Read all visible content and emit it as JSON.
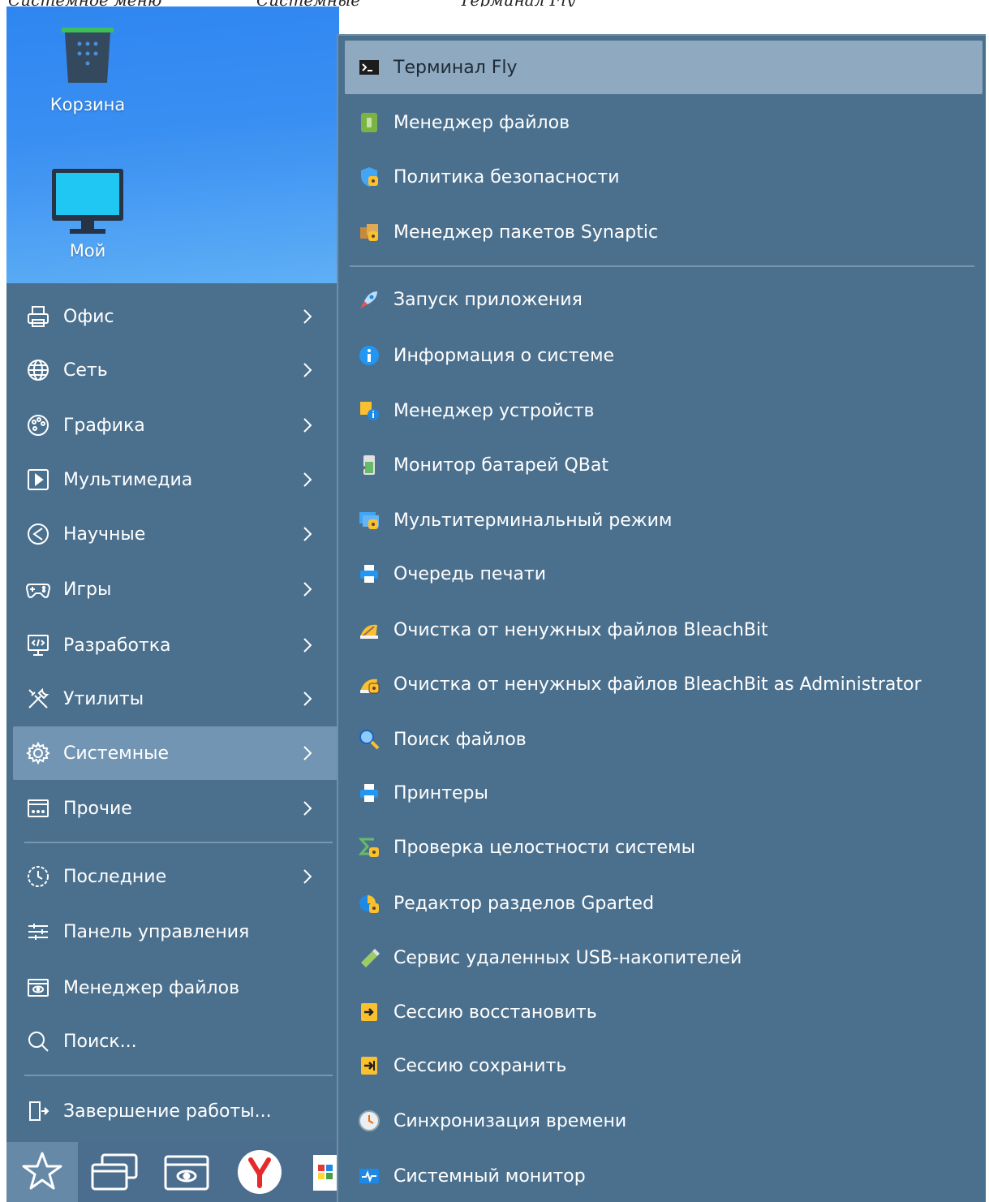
{
  "caption": {
    "left": "Системное меню",
    "middle": "Системные",
    "right": "Терминал Fly"
  },
  "desktop": {
    "trash_label": "Корзина",
    "computer_label": "Мой"
  },
  "start_menu": {
    "categories": [
      {
        "label": "Офис",
        "icon": "printer-icon"
      },
      {
        "label": "Сеть",
        "icon": "globe-icon"
      },
      {
        "label": "Графика",
        "icon": "palette-icon"
      },
      {
        "label": "Мультимедиа",
        "icon": "play-icon"
      },
      {
        "label": "Научные",
        "icon": "science-icon"
      },
      {
        "label": "Игры",
        "icon": "gamepad-icon"
      },
      {
        "label": "Разработка",
        "icon": "code-monitor-icon"
      },
      {
        "label": "Утилиты",
        "icon": "tools-icon"
      },
      {
        "label": "Системные",
        "icon": "gear-icon",
        "active": true
      },
      {
        "label": "Прочие",
        "icon": "window-icon"
      }
    ],
    "extras": [
      {
        "label": "Последние",
        "icon": "history-icon"
      },
      {
        "label": "Панель управления",
        "icon": "sliders-icon"
      },
      {
        "label": "Менеджер файлов",
        "icon": "file-manager-icon"
      },
      {
        "label": "Поиск...",
        "icon": "search-icon"
      }
    ],
    "shutdown_label": "Завершение работы..."
  },
  "submenu": {
    "items": [
      {
        "label": "Терминал Fly",
        "icon": "terminal-icon",
        "active": true
      },
      {
        "label": "Менеджер файлов",
        "icon": "file-manager-icon"
      },
      {
        "label": "Политика безопасности",
        "icon": "shield-icon"
      },
      {
        "label": "Менеджер пакетов Synaptic",
        "icon": "package-icon"
      },
      {
        "label": "Запуск приложения",
        "icon": "rocket-icon"
      },
      {
        "label": "Информация о системе",
        "icon": "info-icon"
      },
      {
        "label": "Менеджер устройств",
        "icon": "devices-icon"
      },
      {
        "label": "Монитор батарей QBat",
        "icon": "battery-icon"
      },
      {
        "label": "Мультитерминальный режим",
        "icon": "multiterminal-icon"
      },
      {
        "label": "Очередь печати",
        "icon": "print-queue-icon"
      },
      {
        "label": "Очистка от ненужных файлов BleachBit",
        "icon": "broom-icon"
      },
      {
        "label": "Очистка от ненужных файлов BleachBit as Administrator",
        "icon": "broom-admin-icon"
      },
      {
        "label": "Поиск файлов",
        "icon": "magnifier-icon"
      },
      {
        "label": "Принтеры",
        "icon": "printer-icon"
      },
      {
        "label": "Проверка целостности системы",
        "icon": "sigma-icon"
      },
      {
        "label": "Редактор разделов Gparted",
        "icon": "gparted-icon"
      },
      {
        "label": "Сервис удаленных USB-накопителей",
        "icon": "usb-icon"
      },
      {
        "label": "Сессию восстановить",
        "icon": "session-restore-icon"
      },
      {
        "label": "Сессию сохранить",
        "icon": "session-save-icon"
      },
      {
        "label": "Синхронизация времени",
        "icon": "clock-icon"
      },
      {
        "label": "Системный монитор",
        "icon": "system-monitor-icon"
      }
    ]
  },
  "taskbar": {
    "buttons": [
      "start-star-icon",
      "windows-icon",
      "file-manager-icon",
      "yandex-browser-icon",
      "app-icon"
    ]
  },
  "colors": {
    "menu_bg": "#4b708e",
    "active_left": "#7195b2",
    "active_right": "#8faac0",
    "desktop": "#3a8ff2"
  }
}
